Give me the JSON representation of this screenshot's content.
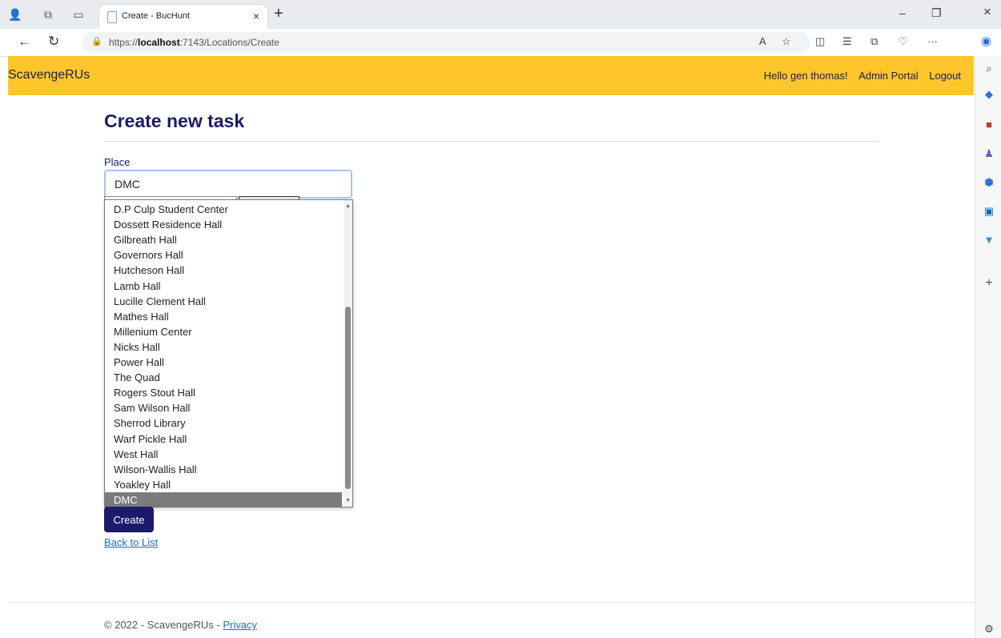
{
  "browser": {
    "tab_title": "Create - BucHunt",
    "tab_close": "×",
    "new_tab": "+",
    "url_prefix": "https://",
    "url_host": "localhost",
    "url_path": ":7143/Locations/Create",
    "more": "···",
    "window_controls": {
      "minimize": "–",
      "restore": "❐",
      "close": "×"
    }
  },
  "navbar": {
    "brand": "ScavengeRUs",
    "greeting": "Hello gen thomas!",
    "admin_portal": "Admin Portal",
    "logout": "Logout"
  },
  "page": {
    "title": "Create new task",
    "place_label": "Place",
    "place_value": "DMC",
    "options": [
      "D.P Culp Student Center",
      "Dossett Residence Hall",
      "Gilbreath Hall",
      "Governors Hall",
      "Hutcheson Hall",
      "Lamb Hall",
      "Lucille Clement Hall",
      "Mathes Hall",
      "Millenium Center",
      "Nicks Hall",
      "Power Hall",
      "The Quad",
      "Rogers Stout Hall",
      "Sam Wilson Hall",
      "Sherrod Library",
      "Warf Pickle Hall",
      "West Hall",
      "Wilson-Wallis Hall",
      "Yoakley Hall",
      "DMC"
    ],
    "selected_option": "DMC",
    "create_button": "Create",
    "back_link": "Back to List"
  },
  "footer": {
    "copyright": "© 2022 - ScavengeRUs - ",
    "privacy": "Privacy"
  },
  "colors": {
    "navbar": "#fec62b",
    "primary": "#1a1b6b",
    "link": "#1a6cd6",
    "selected_option": "#7b7b7b"
  }
}
